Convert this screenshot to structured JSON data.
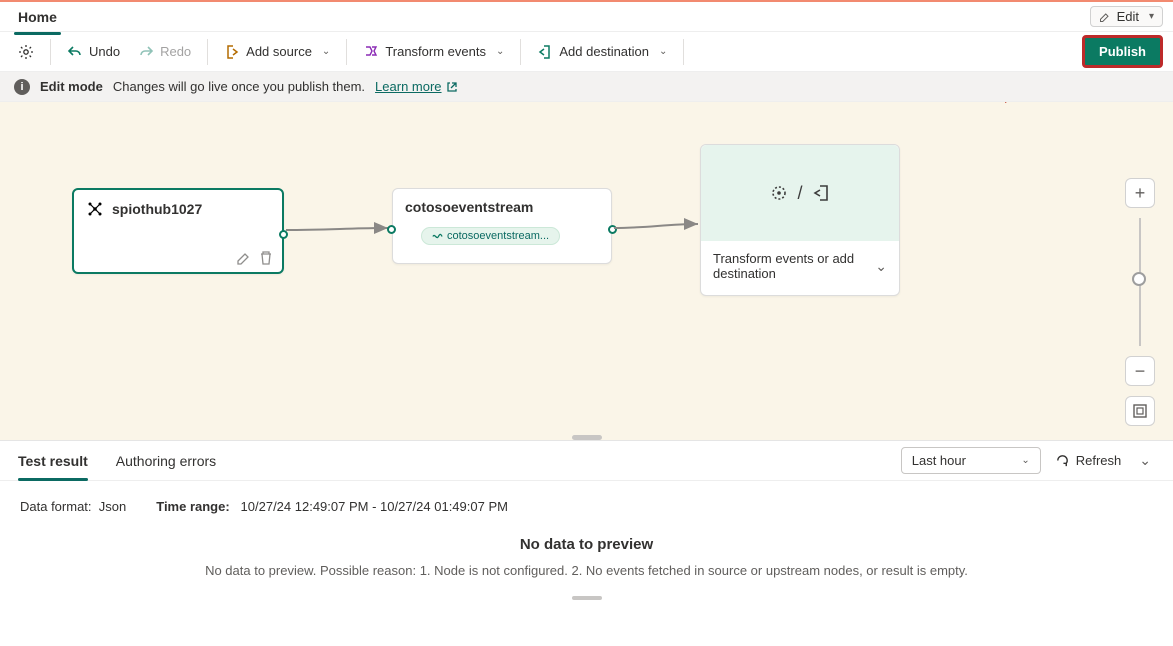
{
  "tabs": {
    "home": "Home"
  },
  "editMenu": {
    "label": "Edit"
  },
  "toolbar": {
    "undo": "Undo",
    "redo": "Redo",
    "addSource": "Add source",
    "transformEvents": "Transform events",
    "addDestination": "Add destination",
    "publish": "Publish"
  },
  "infoBar": {
    "mode": "Edit mode",
    "msg": "Changes will go live once you publish them.",
    "learn": "Learn more"
  },
  "nodes": {
    "source": {
      "label": "spiothub1027"
    },
    "stream": {
      "label": "cotosoeventstream",
      "chip": "cotosoeventstream..."
    },
    "dest": {
      "label": "Transform events or add destination"
    }
  },
  "results": {
    "tabs": {
      "test": "Test result",
      "errors": "Authoring errors"
    },
    "range": {
      "selected": "Last hour"
    },
    "refresh": "Refresh",
    "dataFormatLabel": "Data format:",
    "dataFormat": "Json",
    "timeRangeLabel": "Time range:",
    "timeRange": "10/27/24 12:49:07 PM - 10/27/24 01:49:07 PM",
    "noDataHead": "No data to preview",
    "noDataReason": "No data to preview. Possible reason: 1. Node is not configured. 2. No events fetched in source or upstream nodes, or result is empty."
  }
}
